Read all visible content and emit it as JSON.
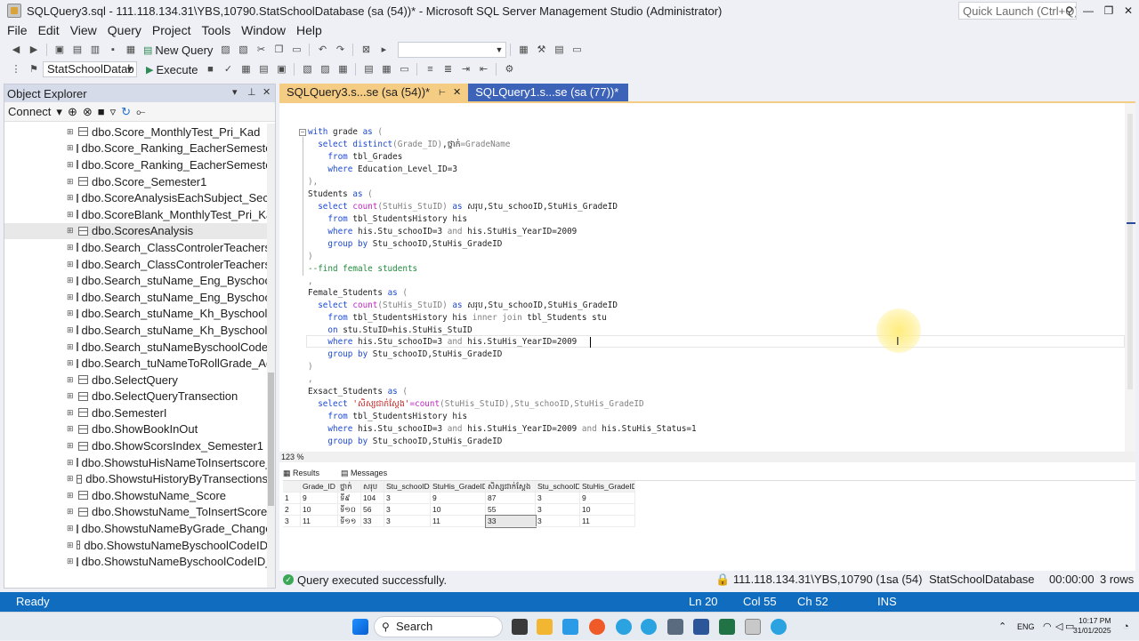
{
  "window": {
    "title": "SQLQuery3.sql - 111.118.134.31\\YBS,10790.StatSchoolDatabase (sa (54))* - Microsoft SQL Server Management Studio (Administrator)",
    "quick_launch": "Quick Launch (Ctrl+Q)"
  },
  "menu": [
    "File",
    "Edit",
    "View",
    "Query",
    "Project",
    "Tools",
    "Window",
    "Help"
  ],
  "toolbar": {
    "new_query": "New Query",
    "database": "StatSchoolDatab",
    "execute": "Execute"
  },
  "object_explorer": {
    "title": "Object Explorer",
    "connect": "Connect",
    "items": [
      "dbo.Score_MonthlyTest_Pri_Kad",
      "dbo.Score_Ranking_EacherSemester",
      "dbo.Score_Ranking_EacherSemester",
      "dbo.Score_Semester1",
      "dbo.ScoreAnalysisEachSubject_Secc",
      "dbo.ScoreBlank_MonthlyTest_Pri_Ka",
      "dbo.ScoresAnalysis",
      "dbo.Search_ClassControlerTeachers",
      "dbo.Search_ClassControlerTeachers",
      "dbo.Search_stuName_Eng_Byschool",
      "dbo.Search_stuName_Eng_Byschool",
      "dbo.Search_stuName_Kh_ByschoolC",
      "dbo.Search_stuName_Kh_ByschoolC",
      "dbo.Search_stuNameByschoolCodel",
      "dbo.Search_tuNameToRollGrade_Ac",
      "dbo.SelectQuery",
      "dbo.SelectQueryTransection",
      "dbo.SemesterI",
      "dbo.ShowBookInOut",
      "dbo.ShowScorsIndex_Semester1",
      "dbo.ShowstuHisNameToInsertscore_",
      "dbo.ShowstuHistoryByTransections",
      "dbo.ShowstuName_Score",
      "dbo.ShowstuName_ToInsertScore",
      "dbo.ShowstuNameByGrade_Change",
      "dbo.ShowstuNameByschoolCodeID",
      "dbo.ShowstuNameByschoolCodeID_"
    ]
  },
  "tabs": {
    "active": "SQLQuery3.s...se (sa (54))*",
    "inactive": "SQLQuery1.s...se (sa (77))*"
  },
  "code": {
    "l1a": "with",
    "l1b": " grade ",
    "l1c": "as",
    "l1d": " (",
    "l2a": "  select",
    "l2b": " distinct",
    "l2c": "(Grade_ID)",
    "l2d": ",ថ្នាក់",
    "l2e": "=GradeName",
    "l3a": "    from",
    "l3b": " tbl_Grades",
    "l4a": "    where",
    "l4b": " Education_Level_ID=3",
    "l5": "),",
    "l6a": "Students ",
    "l6b": "as",
    "l6c": " (",
    "l7a": "  select",
    "l7b": " count",
    "l7c": "(StuHis_StuID) ",
    "l7d": "as",
    "l7e": " សរុប,Stu_schooID,StuHis_GradeID",
    "l8a": "    from",
    "l8b": " tbl_StudentsHistory his",
    "l9a": "    where",
    "l9b": " his.Stu_schooID=3 ",
    "l9c": "and",
    "l9d": " his.StuHis_YearID=2009",
    "l10a": "    group by",
    "l10b": " Stu_schooID,StuHis_GradeID",
    "l11": ")",
    "l12": "--find female students",
    "l13": ",",
    "l14a": "Female_Students ",
    "l14b": "as",
    "l14c": " (",
    "l15a": "  select",
    "l15b": " count",
    "l15c": "(StuHis_StuID) ",
    "l15d": "as",
    "l15e": " សរុប,Stu_schooID,StuHis_GradeID",
    "l16a": "    from",
    "l16b": " tbl_StudentsHistory his ",
    "l16c": "inner join",
    "l16d": " tbl_Students stu",
    "l17a": "    on",
    "l17b": " stu.StuID=his.StuHis_StuID",
    "l18a": "    where",
    "l18b": " his.Stu_schooID=3 ",
    "l18c": "and",
    "l18d": " his.StuHis_YearID=2009",
    "l19a": "    group by",
    "l19b": " Stu_schooID,StuHis_GradeID",
    "l20": ")",
    "l21": ",",
    "l22a": "Exsact_Students ",
    "l22b": "as",
    "l22c": " (",
    "l23a": "  select",
    "l23b": " 'សិស្សជាក់ស្តែង'",
    "l23c": "=count",
    "l23d": "(StuHis_StuID),Stu_schooID,StuHis_GradeID",
    "l24a": "    from",
    "l24b": " tbl_StudentsHistory his",
    "l25a": "    where",
    "l25b": " his.Stu_schooID=3 ",
    "l25c": "and",
    "l25d": " his.StuHis_YearID=2009 ",
    "l25e": "and",
    "l25f": " his.StuHis_Status=1",
    "l26a": "    group by",
    "l26b": " Stu_schooID,StuHis_GradeID"
  },
  "zoom": "123 %",
  "results": {
    "tab_results": "Results",
    "tab_messages": "Messages",
    "columns": [
      "Grade_ID",
      "ថ្នាក់",
      "សរុប",
      "Stu_schooID",
      "StuHis_GradeID",
      "សិស្សជាក់ស្តែង",
      "Stu_schooID",
      "StuHis_GradeID"
    ],
    "rows": [
      [
        "1",
        "9",
        "ទី៩",
        "104",
        "3",
        "9",
        "87",
        "3",
        "9"
      ],
      [
        "2",
        "10",
        "ទី១០",
        "56",
        "3",
        "10",
        "55",
        "3",
        "10"
      ],
      [
        "3",
        "11",
        "ទី១១",
        "33",
        "3",
        "11",
        "33",
        "3",
        "11"
      ]
    ]
  },
  "query_status": {
    "message": "Query executed successfully.",
    "server": "111.118.134.31\\YBS,10790 (1...",
    "user": "sa (54)",
    "database": "StatSchoolDatabase",
    "elapsed": "00:00:00",
    "rows": "3 rows"
  },
  "statusbar": {
    "ready": "Ready",
    "ln": "Ln 20",
    "col": "Col 55",
    "ch": "Ch 52",
    "ins": "INS"
  },
  "taskbar": {
    "search": "Search",
    "lang": "ENG",
    "time": "10:17 PM",
    "date": "31/01/2025"
  },
  "colors": {
    "statusbar": "#0f6cbf",
    "active_tab": "#f5cc84",
    "inactive_tab": "#3d63b8",
    "keyword": "#1c49d3",
    "comment": "#228a3c",
    "string": "#c22020"
  }
}
